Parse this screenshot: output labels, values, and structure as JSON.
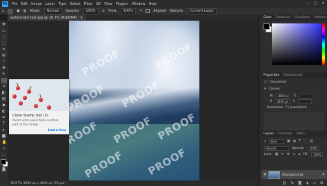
{
  "app": {
    "logo": "Ps"
  },
  "menu": [
    "File",
    "Edit",
    "Image",
    "Layer",
    "Type",
    "Select",
    "Filter",
    "3D",
    "View",
    "Plugins",
    "Window",
    "Help"
  ],
  "options": {
    "mode_label": "Mode:",
    "mode_value": "Normal",
    "opacity_label": "Opacity:",
    "opacity_value": "100%",
    "flow_label": "Flow:",
    "flow_value": "100%",
    "aligned_label": "Aligned",
    "sample_label": "Sample:",
    "sample_value": "Current Layer"
  },
  "document": {
    "tab_title": "watermark test.jpg @ 16.7% (RGB/8#)",
    "close": "×"
  },
  "watermark_text": "PROOF",
  "status": {
    "text": "16.67%     3000 px x 4640 px (72 ppi)"
  },
  "tooltip": {
    "title": "Clone Stamp tool (S)",
    "description": "Paints with pixels from another part of the image",
    "link": "Learn how"
  },
  "panels": {
    "color_tabs": [
      "Color",
      "Swatches",
      "Gradients",
      "Patterns"
    ],
    "properties_tabs": [
      "Properties",
      "Adjustments"
    ],
    "doc_label": "Document",
    "canvas_label": "Canvas",
    "width_label": "W",
    "width_value": "3000 px",
    "height_label": "H",
    "height_value": "4640 px",
    "x_label": "X",
    "y_label": "Y",
    "resolution": "Resolution: 72 pixels/inch",
    "layers_tabs": [
      "Layers",
      "Channels",
      "Paths"
    ],
    "kind_label": "Kind",
    "blend_value": "Normal",
    "opacity_label": "Opacity:",
    "opacity_value": "100%",
    "lock_label": "Lock:",
    "fill_label": "Fill:",
    "fill_value": "100%",
    "layer_name": "Background"
  },
  "colors": {
    "foreground": "#000000",
    "background": "#ffffff",
    "accent": "#1473e6"
  }
}
